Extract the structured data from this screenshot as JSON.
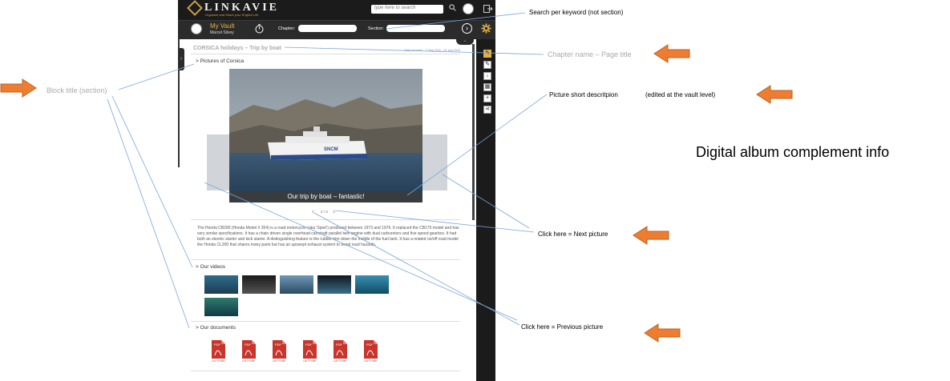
{
  "app": {
    "brand": "LINKAVIE",
    "tagline": "Organize and Share your English Life",
    "search_placeholder": "type here to search",
    "vault_title": "My Vault",
    "vault_user": "Marcel Silvey",
    "chapter_label": "Chapter:",
    "section_label": "Section:",
    "accent": "#e3b341"
  },
  "page": {
    "title": "CORSICA holidays – Trip by boat",
    "date": "Date recorded : 17 Aug 2015 - 23° Aug 2015",
    "pictures_title": "> Pictures of Corsica",
    "photo_caption": "Our trip by boat – fantastic!",
    "photo_counter": "2 / 3",
    "description": "The Honda CB200 (Honda Model # 354) is a road motorcycle (aka 'Sport') produced between 1973 and 1976. It replaced the CB175 model and has very similar specifications. It has a chain driven single overhead camshaft parallel twin engine with dual carburetors and five speed gearbox. It had both an electric starter and kick starter. A distinguishing feature is the rubber trim down the middle of the fuel tank. It has a related on/off road model the Honda CL200 that shares many parts but has an upswept exhaust system to avoid road hazards.",
    "videos_title": "> Our videos",
    "documents_title": "> Our documents",
    "documents": [
      "Car Profile",
      "Car Profile",
      "Car Profile",
      "Car Profile",
      "Car Profile",
      "Car Profile"
    ]
  },
  "annotations": {
    "search": "Search per keyword (not section)",
    "chapter": "Chapter name – Page title",
    "block": "Block title (section)",
    "picture": "Picture short descritpion",
    "picture_note": "(edited at the vault level)",
    "album": "Digital album complement info",
    "next": "Click here = Next picture",
    "previous": "Click here = Previous picture"
  }
}
